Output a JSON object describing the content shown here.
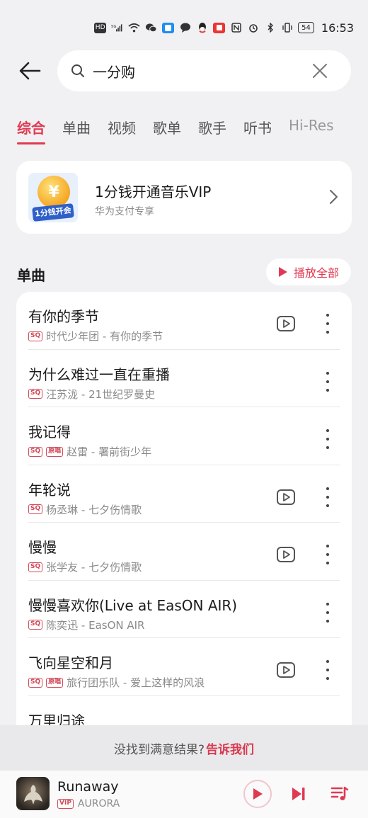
{
  "status_bar": {
    "hd": "HD",
    "signal": "5G",
    "battery": "54",
    "time": "16:53"
  },
  "search": {
    "value": "一分购"
  },
  "tabs": [
    {
      "label": "综合",
      "active": true
    },
    {
      "label": "单曲"
    },
    {
      "label": "视频"
    },
    {
      "label": "歌单"
    },
    {
      "label": "歌手"
    },
    {
      "label": "听书"
    },
    {
      "label": "Hi-Res"
    }
  ],
  "vip_card": {
    "logo_symbol": "¥",
    "logo_text": "1分钱开会员",
    "title": "1分钱开通音乐VIP",
    "subtitle": "华为支付专享"
  },
  "songs_section": {
    "title": "单曲",
    "play_all": "播放全部"
  },
  "songs": [
    {
      "title": "有你的季节",
      "badges": [
        "SQ"
      ],
      "meta": "时代少年团 - 有你的季节",
      "video": true
    },
    {
      "title": "为什么难过一直在重播",
      "badges": [
        "SQ"
      ],
      "meta": "汪苏泷 - 21世纪罗曼史",
      "video": false
    },
    {
      "title": "我记得",
      "badges": [
        "SQ",
        "原唱"
      ],
      "meta": "赵雷 - 署前街少年",
      "video": false
    },
    {
      "title": "年轮说",
      "badges": [
        "SQ"
      ],
      "meta": "杨丞琳 - 七夕伤情歌",
      "video": true
    },
    {
      "title": "慢慢",
      "badges": [
        "SQ"
      ],
      "meta": "张学友 - 七夕伤情歌",
      "video": true
    },
    {
      "title": "慢慢喜欢你(Live at EasON AIR)",
      "badges": [
        "SQ"
      ],
      "meta": "陈奕迅 - EasON AIR",
      "video": false
    },
    {
      "title": "飞向星空和月",
      "badges": [
        "SQ",
        "原唱"
      ],
      "meta": "旅行团乐队 - 爱上这样的风浪",
      "video": true
    },
    {
      "title": "万里归途",
      "badges": [],
      "meta": "",
      "video": false
    }
  ],
  "feedback": {
    "text": "没找到满意结果?",
    "link": "告诉我们"
  },
  "player": {
    "title": "Runaway",
    "badge": "VIP",
    "artist": "AURORA"
  },
  "colors": {
    "accent": "#e03a52",
    "background": "#f1f1f3"
  }
}
